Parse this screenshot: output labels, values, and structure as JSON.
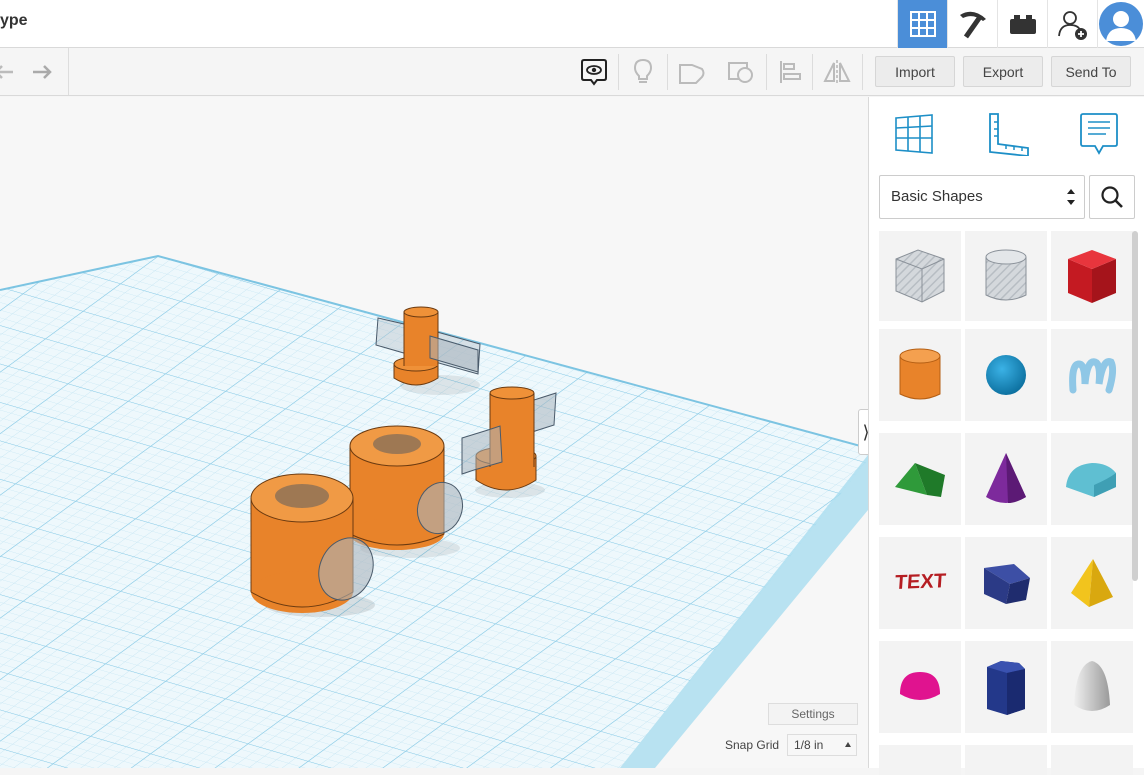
{
  "header": {
    "design_title": "ype",
    "nav_icons": [
      "grid-view-icon",
      "pickaxe-icon",
      "bricks-icon",
      "add-user-icon",
      "user-avatar"
    ]
  },
  "toolbar": {
    "left_icons": [
      "undo-icon",
      "redo-icon"
    ],
    "right_icons": [
      "notes-visibility-icon",
      "lightbulb-icon",
      "solid-shape-icon",
      "hole-shape-icon",
      "align-icon",
      "mirror-icon"
    ],
    "import_label": "Import",
    "export_label": "Export",
    "send_to_label": "Send To"
  },
  "panel": {
    "tools": [
      "workplane-icon",
      "ruler-icon",
      "notes-icon"
    ],
    "category_selected": "Basic Shapes",
    "shapes": [
      "box-hole",
      "cylinder-hole",
      "box",
      "cylinder",
      "sphere",
      "scribble",
      "roof",
      "cone",
      "round-roof",
      "text",
      "wedge",
      "pyramid",
      "half-sphere",
      "polygon",
      "paraboloid"
    ]
  },
  "workplane": {
    "settings_label": "Settings",
    "snap_grid_label": "Snap Grid",
    "snap_grid_value": "1/8 in"
  },
  "colors": {
    "accent_blue": "#4b8ed8",
    "shape_orange": "#e8832a",
    "grid_blue": "#8fd0ea",
    "box_red": "#d8202a"
  }
}
